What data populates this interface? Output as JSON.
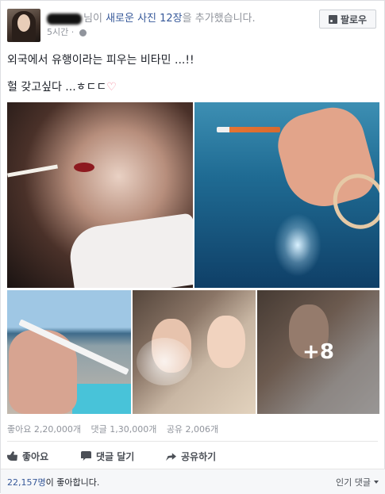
{
  "post": {
    "header": {
      "name_suffix": "님이",
      "action_link": "새로운 사진 12장",
      "action_tail": "을 추가했습니다.",
      "time": "5시간",
      "follow_label": "팔로우"
    },
    "body": {
      "line1": "외국에서 유행이라는 피우는 비타민 ...!!",
      "line2": "헐 갖고싶다 ...ㅎㄷㄷ",
      "heart": "♡"
    },
    "photos": {
      "more_count": "+8"
    },
    "stats": {
      "likes": "좋아요 2,20,000개",
      "comments": "댓글 1,30,000개",
      "shares": "공유 2,006개"
    },
    "actions": {
      "like": "좋아요",
      "comment": "댓글 달기",
      "share": "공유하기"
    },
    "footer": {
      "like_count": "22,157명",
      "like_text": "이 좋아합니다.",
      "sort_label": "인기 댓글"
    }
  }
}
